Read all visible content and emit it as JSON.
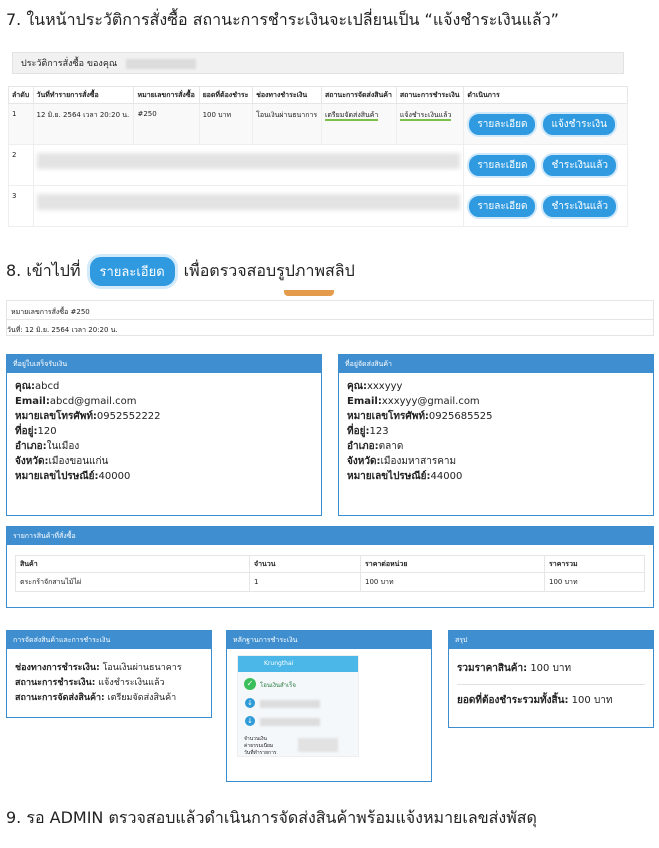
{
  "step7": "7.  ในหน้าประวัติการสั่งซื้อ สถานะการชำระเงินจะเปลี่ยนเป็น “แจ้งชำระเงินแล้ว”",
  "step8_prefix": "8.  เข้าไปที่",
  "step8_button": "รายละเอียด",
  "step8_suffix": "เพื่อตรวจสอบรูปภาพสลิป",
  "step9": "9.  รอ ADMIN ตรวจสอบแล้วดำเนินการจัดส่งสินค้าพร้อมแจ้งหมายเลขส่งพัสดุ",
  "history": {
    "header": "ประวัติการสั่งซื้อ ของคุณ",
    "columns": [
      "ลำดับ",
      "วันที่ทำรายการสั่งซื้อ",
      "หมายเลขการสั่งซื้อ",
      "ยอดที่ต้องชำระ",
      "ช่องทางชำระเงิน",
      "สถานะการจัดส่งสินค้า",
      "สถานะการชำระเงิน",
      "ดำเนินการ"
    ],
    "row1": {
      "no": "1",
      "date": "12 มิ.ย. 2564 เวลา 20:20 น.",
      "order": "#250",
      "amount": "100 บาท",
      "channel": "โอนเงินผ่านธนาการ",
      "ship": "เตรียมจัดส่งสินค้า",
      "pay": "แจ้งชำระเงินแล้ว",
      "btn_detail": "รายละเอียด",
      "btn_action": "แจ้งชำระเงิน"
    },
    "row2": {
      "no": "2",
      "btn_detail": "รายละเอียด",
      "btn_action": "ชำระเงินแล้ว"
    },
    "row3": {
      "no": "3",
      "btn_detail": "รายละเอียด",
      "btn_action": "ชำระเงินแล้ว"
    }
  },
  "detail": {
    "order_no": "หมายเลขการสั่งซื้อ #250",
    "date": "วันที่: 12 มิ.ย. 2564 เวลา 20:20 น.",
    "buyer": {
      "title": "ที่อยู่ใบเสร็จรับเงิน",
      "name_k": "คุณ:",
      "name_v": "abcd",
      "email_k": "Email:",
      "email_v": "abcd@gmail.com",
      "tel_k": "หมายเลขโทรศัพท์:",
      "tel_v": "0952552222",
      "addr_k": "ที่อยู่:",
      "addr_v": "120",
      "dist_k": "อำเภอ:",
      "dist_v": "ในเมือง",
      "prov_k": "จังหวัด:",
      "prov_v": "เมืองขอนแก่น",
      "zip_k": "หมายเลขไปรษณีย์:",
      "zip_v": "40000"
    },
    "ship": {
      "title": "ที่อยู่จัดส่งสินค้า",
      "name_k": "คุณ:",
      "name_v": "xxxyyy",
      "email_k": "Email:",
      "email_v": "xxxyyy@gmail.com",
      "tel_k": "หมายเลขโทรศัพท์:",
      "tel_v": "0925685525",
      "addr_k": "ที่อยู่:",
      "addr_v": "123",
      "dist_k": "อำเภอ:",
      "dist_v": "ตลาด",
      "prov_k": "จังหวัด:",
      "prov_v": "เมืองมหาสารคาม",
      "zip_k": "หมายเลขไปรษณีย์:",
      "zip_v": "44000"
    },
    "items": {
      "title": "รายการสินค้าที่สั่งซื้อ",
      "cols": [
        "สินค้า",
        "จำนวน",
        "ราคาต่อหน่วย",
        "ราคารวม"
      ],
      "row": [
        "ตระกร้าจักสานไม้ไผ่",
        "1",
        "100 บาท",
        "100 บาท"
      ]
    },
    "payment": {
      "title": "การจัดส่งสินค้าและการชำระเงิน",
      "ch_k": "ช่องทางการชำระเงิน:",
      "ch_v": "โอนเงินผ่านธนาคาร",
      "pay_k": "สถานะการชำระเงิน:",
      "pay_v": "แจ้งชำระเงินแล้ว",
      "ship_k": "สถานะการจัดส่งสินค้า:",
      "ship_v": "เตรียมจัดส่งสินค้า"
    },
    "proof": {
      "title": "หลักฐานการชำระเงิน",
      "bank": "Krungthai",
      "success": "โอนเงินสำเร็จ",
      "l1": "จำนวนเงิน",
      "l2": "ค่าธรรมเนียม",
      "l3": "วันที่ทำรายการ"
    },
    "summary": {
      "title": "สรุป",
      "total_k": "รวมราคาสินค้า:",
      "total_v": "100 บาท",
      "due_k": "ยอดที่ต้องชำระรวมทั้งสิ้น:",
      "due_v": "100 บาท"
    }
  }
}
